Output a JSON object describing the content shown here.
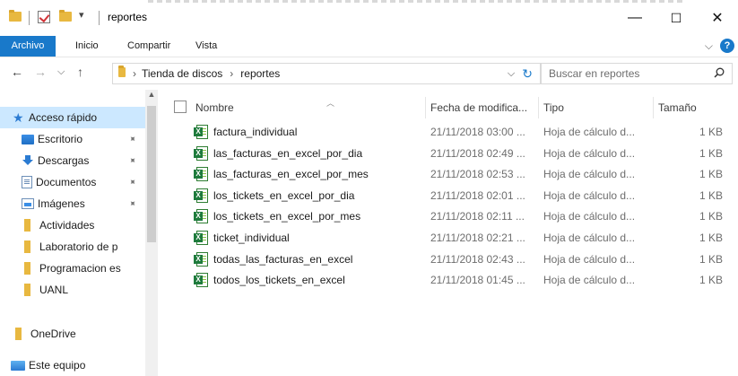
{
  "window": {
    "title": "reportes",
    "minimize": "—",
    "maximize": "☐",
    "close": "✕"
  },
  "ribbon": {
    "tabs": [
      "Archivo",
      "Inicio",
      "Compartir",
      "Vista"
    ],
    "expand": "⌵",
    "help": "?"
  },
  "address": {
    "back": "←",
    "forward": "→",
    "recent": "⌵",
    "up": "↑",
    "path": [
      "Tienda de discos",
      "reportes"
    ],
    "separator": "›",
    "dropdown": "⌵",
    "refresh": "↻",
    "search_placeholder": "Buscar en reportes"
  },
  "nav": {
    "items": [
      {
        "label": "Acceso rápido",
        "icon": "star-icon",
        "selected": true
      },
      {
        "label": "Escritorio",
        "icon": "desktop-icon",
        "pinned": true
      },
      {
        "label": "Descargas",
        "icon": "downloads-icon",
        "pinned": true
      },
      {
        "label": "Documentos",
        "icon": "documents-icon",
        "pinned": true
      },
      {
        "label": "Imágenes",
        "icon": "pictures-icon",
        "pinned": true
      },
      {
        "label": "Actividades",
        "icon": "folder-icon"
      },
      {
        "label": "Laboratorio de p",
        "icon": "folder-icon"
      },
      {
        "label": "Programacion es",
        "icon": "folder-icon"
      },
      {
        "label": "UANL",
        "icon": "folder-icon"
      },
      {
        "label": "OneDrive",
        "icon": "onedrive-icon"
      },
      {
        "label": "Este equipo",
        "icon": "computer-icon"
      }
    ]
  },
  "columns": {
    "name": "Nombre",
    "date": "Fecha de modifica...",
    "type": "Tipo",
    "size": "Tamaño"
  },
  "files": [
    {
      "name": "factura_individual",
      "date": "21/11/2018 03:00 ...",
      "type": "Hoja de cálculo d...",
      "size": "1 KB"
    },
    {
      "name": "las_facturas_en_excel_por_dia",
      "date": "21/11/2018 02:49 ...",
      "type": "Hoja de cálculo d...",
      "size": "1 KB"
    },
    {
      "name": "las_facturas_en_excel_por_mes",
      "date": "21/11/2018 02:53 ...",
      "type": "Hoja de cálculo d...",
      "size": "1 KB"
    },
    {
      "name": "los_tickets_en_excel_por_dia",
      "date": "21/11/2018 02:01 ...",
      "type": "Hoja de cálculo d...",
      "size": "1 KB"
    },
    {
      "name": "los_tickets_en_excel_por_mes",
      "date": "21/11/2018 02:11 ...",
      "type": "Hoja de cálculo d...",
      "size": "1 KB"
    },
    {
      "name": "ticket_individual",
      "date": "21/11/2018 02:21 ...",
      "type": "Hoja de cálculo d...",
      "size": "1 KB"
    },
    {
      "name": "todas_las_facturas_en_excel",
      "date": "21/11/2018 02:43 ...",
      "type": "Hoja de cálculo d...",
      "size": "1 KB"
    },
    {
      "name": "todos_los_tickets_en_excel",
      "date": "21/11/2018 01:45 ...",
      "type": "Hoja de cálculo d...",
      "size": "1 KB"
    }
  ],
  "colors": {
    "accent": "#1979ca",
    "selected_nav": "#cce8ff",
    "folder": "#e8b840",
    "excel": "#1e7b3c"
  }
}
